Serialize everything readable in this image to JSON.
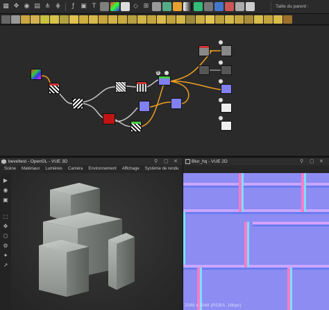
{
  "graph_toolbar": {
    "parent_size_label": "Taille du parent :"
  },
  "panel_3d": {
    "title": "beveltest - OpenGL - VUE 3D",
    "menu": [
      "Scène",
      "Matériaux",
      "Lumières",
      "Caméra",
      "Environnement",
      "Affichage",
      "Système de rendu"
    ]
  },
  "panel_2d": {
    "title": "Blur_hq - VUE 2D",
    "status": "2048 x 2048 (RGBA, 16bpc)"
  },
  "colors": {
    "normal_map_base": "#8c8cf2",
    "accent_orange": "#f0a020",
    "wire_gray": "#c8c8c8"
  }
}
